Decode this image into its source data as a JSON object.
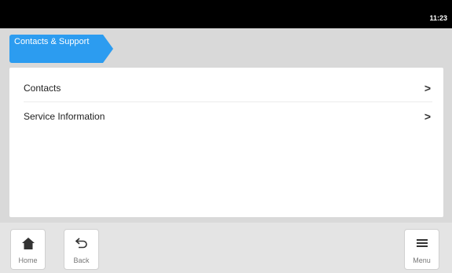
{
  "status_bar": {
    "time": "11:23"
  },
  "breadcrumb": {
    "label": "Contacts & Support"
  },
  "menu_items": [
    {
      "label": "Contacts",
      "chevron": ">"
    },
    {
      "label": "Service Information",
      "chevron": ">"
    }
  ],
  "bottom_nav": {
    "home_label": "Home",
    "back_label": "Back",
    "menu_label": "Menu",
    "home_icon": "home-icon",
    "back_icon": "back-arrow-icon",
    "menu_icon": "hamburger-menu-icon"
  },
  "colors": {
    "accent": "#2c9cf0",
    "background": "#d9d9d9",
    "status_bar": "#000000"
  }
}
